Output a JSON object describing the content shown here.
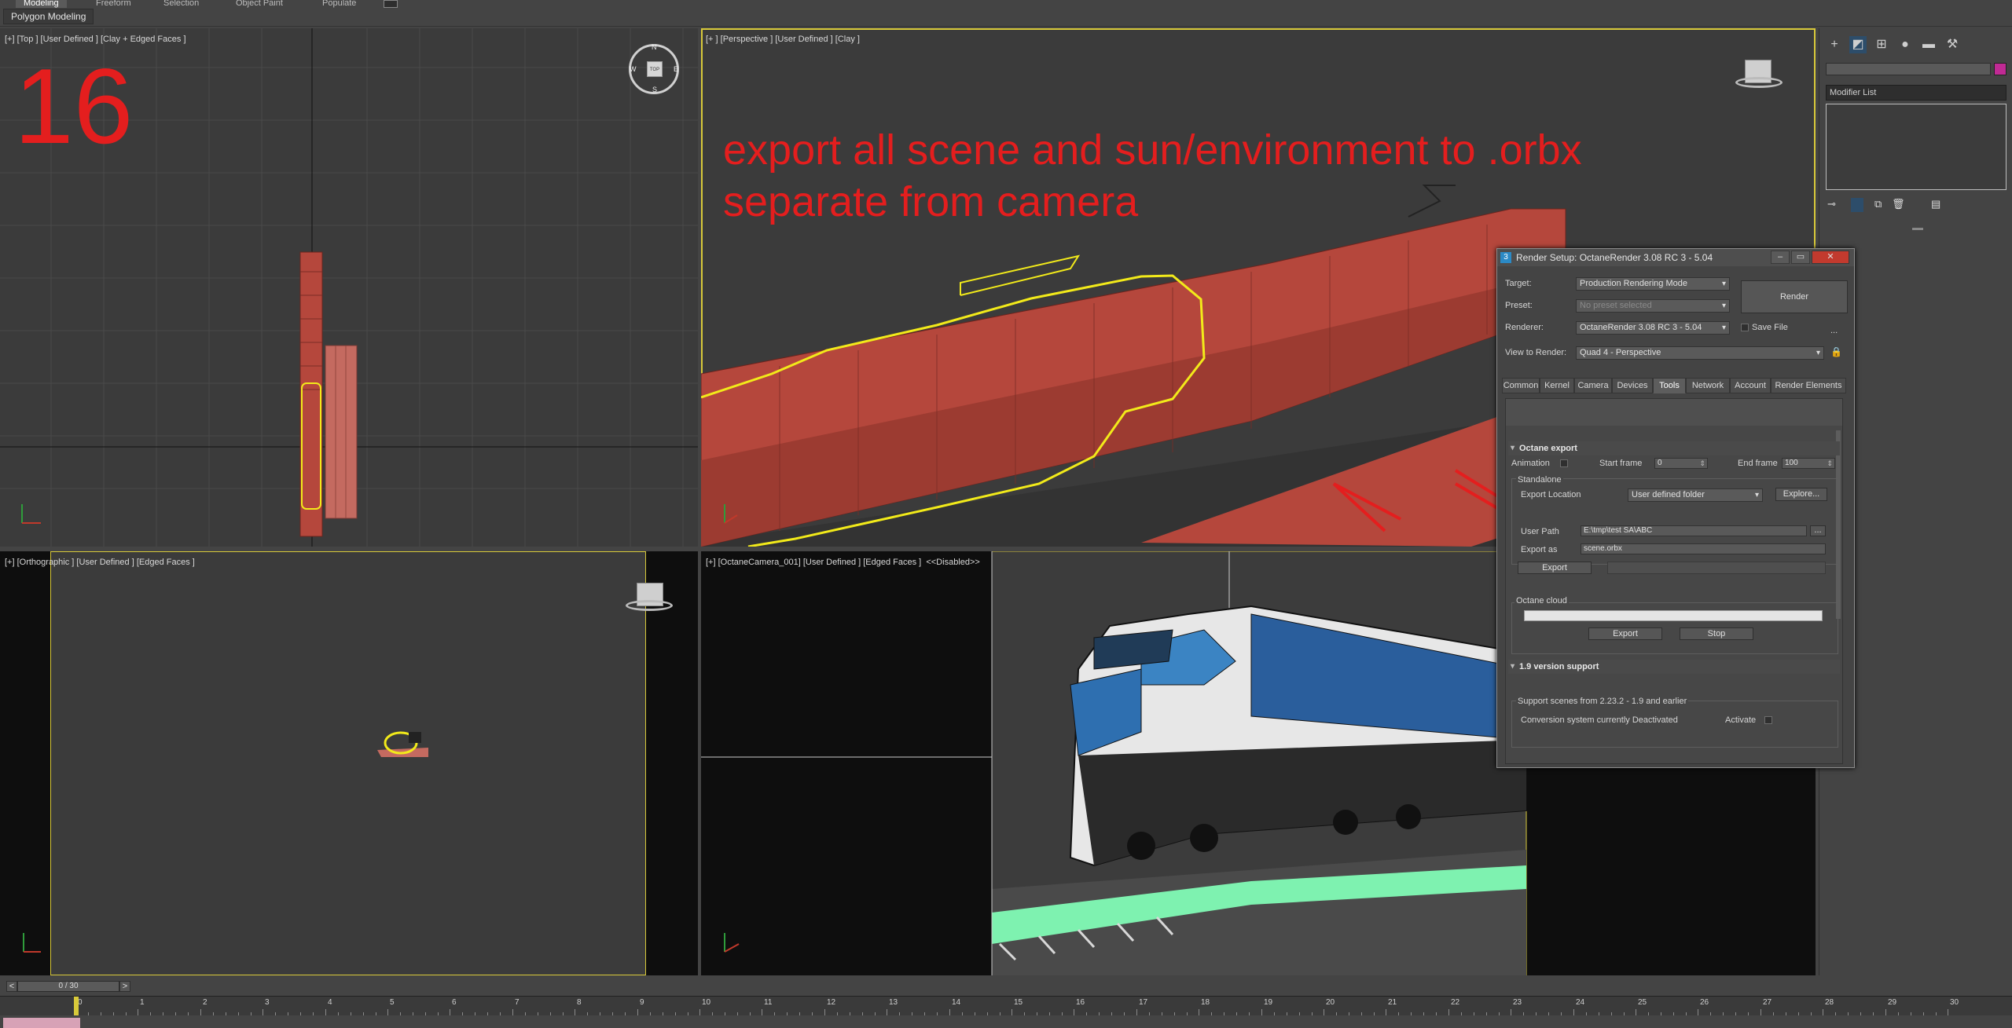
{
  "ribbon": {
    "tabs": [
      "Modeling",
      "Freeform",
      "Selection",
      "Object Paint",
      "Populate"
    ],
    "sub_label": "Polygon Modeling"
  },
  "viewports": {
    "top": {
      "label": "[+] [Top ] [User Defined ] [Clay + Edged Faces ]",
      "step_number": "16"
    },
    "perspective": {
      "label": "[+ ] [Perspective ] [User Defined ] [Clay ]",
      "annotation_line1": "export all scene and sun/environment to .orbx",
      "annotation_line2": "separate from camera"
    },
    "ortho": {
      "label": "[+] [Orthographic ] [User Defined ] [Edged Faces ]"
    },
    "camera": {
      "label": "[+] [OctaneCamera_001] [User Defined ] [Edged Faces ]  <<Disabled>>"
    },
    "viewcube": {
      "top_face": "TOP",
      "compass_n": "N",
      "compass_s": "S",
      "compass_e": "E",
      "compass_w": "W"
    }
  },
  "command_panel": {
    "modifier_list": "Modifier List"
  },
  "render_setup": {
    "title": "Render Setup: OctaneRender 3.08 RC 3 - 5.04",
    "target_label": "Target:",
    "target_value": "Production Rendering Mode",
    "preset_label": "Preset:",
    "preset_value": "No preset selected",
    "renderer_label": "Renderer:",
    "renderer_value": "OctaneRender 3.08 RC 3 - 5.04",
    "save_file_label": "Save File",
    "view_label": "View to Render:",
    "view_value": "Quad 4 - Perspective",
    "render_button": "Render",
    "more_button": "...",
    "tabs": [
      "Common",
      "Kernel",
      "Camera",
      "Devices",
      "Tools",
      "Network",
      "Account",
      "Render Elements"
    ],
    "active_tab": "Tools",
    "octane_export": {
      "header": "Octane export",
      "animation_label": "Animation",
      "start_frame_label": "Start frame",
      "start_frame_value": "0",
      "end_frame_label": "End frame",
      "end_frame_value": "100",
      "standalone_label": "Standalone",
      "export_location_label": "Export Location",
      "export_location_value": "User defined folder",
      "explore_button": "Explore...",
      "user_path_label": "User Path",
      "user_path_value": "E:\\tmp\\test SA\\ABC",
      "browse_button": "...",
      "export_as_label": "Export as",
      "export_as_value": "scene.orbx",
      "export_button": "Export",
      "cloud_label": "Octane cloud",
      "cloud_export_button": "Export",
      "cloud_stop_button": "Stop"
    },
    "version_support": {
      "header": "1.9 version support",
      "group_label": "Support scenes from 2.23.2 - 1.9 and earlier",
      "status_text": "Conversion system currently Deactivated",
      "activate_label": "Activate"
    }
  },
  "timeline": {
    "frame_display": "0 / 30",
    "prev": "<",
    "next": ">",
    "ticks": [
      "0",
      "1",
      "2",
      "3",
      "4",
      "5",
      "6",
      "7",
      "8",
      "9",
      "10",
      "11",
      "12",
      "13",
      "14",
      "15",
      "16",
      "17",
      "18",
      "19",
      "20",
      "21",
      "22",
      "23",
      "24",
      "25",
      "26",
      "27",
      "28",
      "29",
      "30"
    ]
  },
  "colors": {
    "annotation": "#e41e1e",
    "selection_outline": "#f2ea1a",
    "train_clay": "#b5473c",
    "track_highlight": "#7ef2b0"
  }
}
